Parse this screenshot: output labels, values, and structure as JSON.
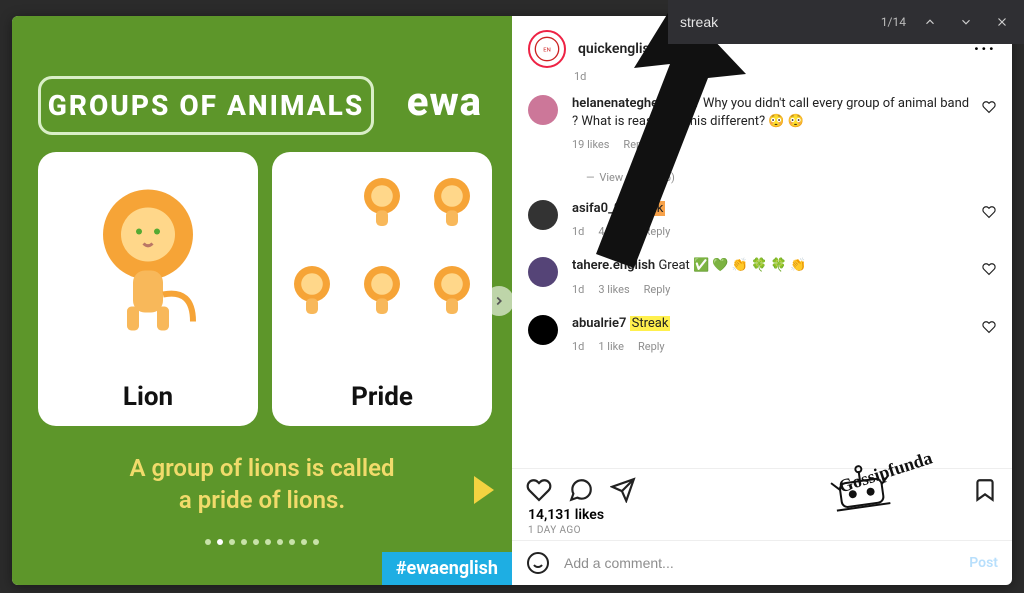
{
  "findbar": {
    "query": "streak",
    "count": "1/14"
  },
  "post": {
    "author": "quickenglishfluency",
    "age": "1d",
    "likes": "14,131 likes",
    "timestamp": "1 DAY AGO"
  },
  "media": {
    "title": "GROUPS OF ANIMALS",
    "brand": "ewa",
    "card_left": "Lion",
    "card_right": "Pride",
    "caption_l1": "A group of lions is called",
    "caption_l2": "a pride of lions.",
    "hashtag": "#ewaenglish"
  },
  "comments": [
    {
      "user": "helanenategheh",
      "text": "Why? Why you didn't call every group of animal band ? What is reason of this different? 😳 😳",
      "age": "",
      "likes": "19 likes",
      "reply": "Reply",
      "replies": "View replies (6)",
      "avatar": "#c79"
    },
    {
      "user": "asifa0_0",
      "text": "Streak",
      "age": "1d",
      "likes": "4 likes",
      "reply": "Reply",
      "avatar": "#333",
      "hl": "o"
    },
    {
      "user": "tahere.english",
      "text": "Great ✅ 💚 👏 🍀 🍀 👏",
      "age": "1d",
      "likes": "3 likes",
      "reply": "Reply",
      "avatar": "#547"
    },
    {
      "user": "abualrie7",
      "text": "Streak",
      "age": "1d",
      "likes": "1 like",
      "reply": "Reply",
      "avatar": "#000",
      "hl": "y"
    }
  ],
  "compose": {
    "placeholder": "Add a comment...",
    "post": "Post"
  },
  "watermark": "Gossipfunda"
}
